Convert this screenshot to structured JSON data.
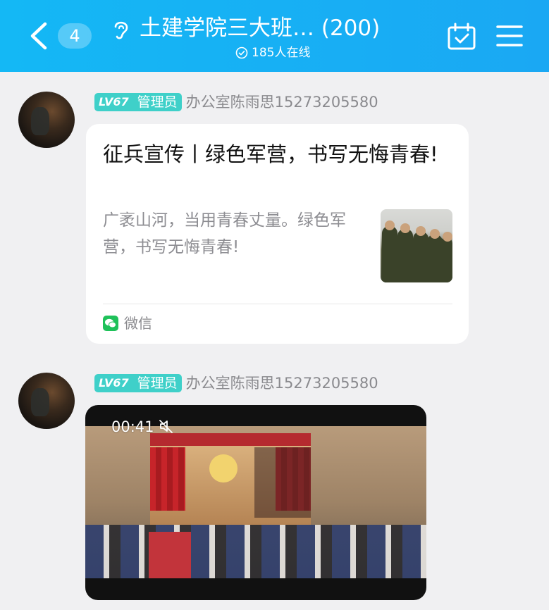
{
  "header": {
    "back_badge": "4",
    "title": "土建学院三大班… (200)",
    "online": "185人在线"
  },
  "messages": [
    {
      "level": "LV67",
      "role": "管理员",
      "sender": "办公室陈雨思15273205580",
      "card": {
        "title": "征兵宣传丨绿色军营，书写无悔青春!",
        "description": "广袤山河，当用青春丈量。绿色军营，书写无悔青春!",
        "source": "微信"
      }
    },
    {
      "level": "LV67",
      "role": "管理员",
      "sender": "办公室陈雨思15273205580",
      "video": {
        "time": "00:41"
      }
    }
  ],
  "colors": {
    "header": "#14b8f5",
    "level_badge": "#3fd0c9",
    "background": "#f0f0f2"
  }
}
